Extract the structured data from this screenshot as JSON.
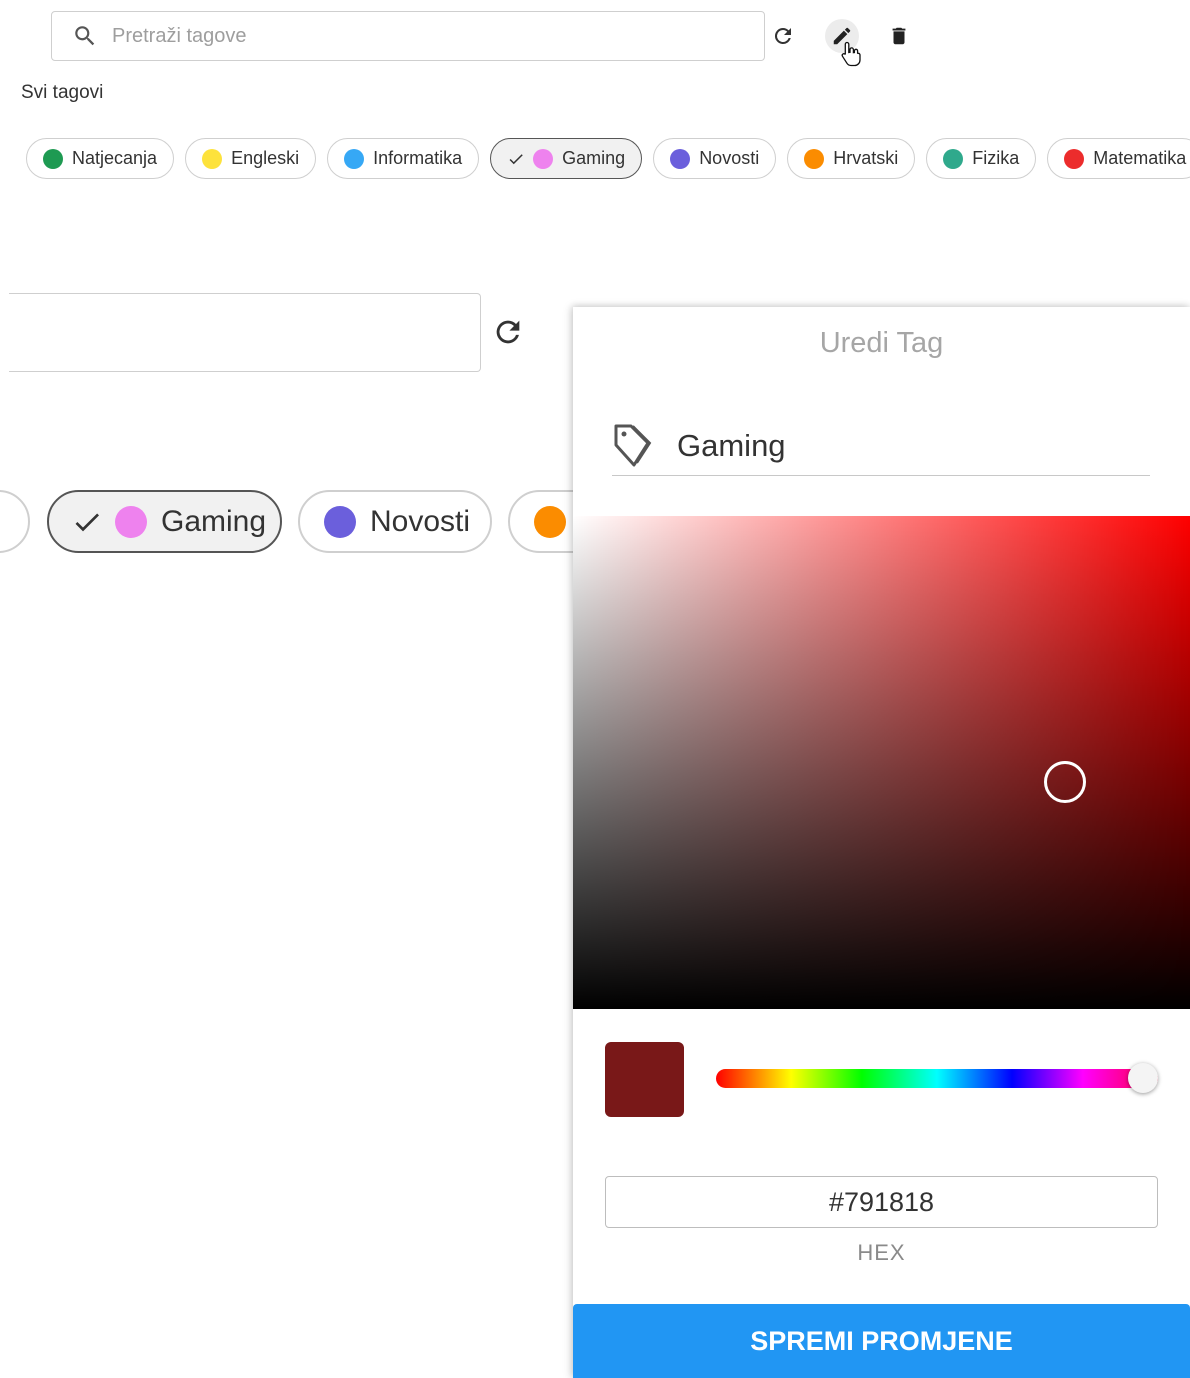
{
  "search": {
    "placeholder": "Pretraži tagove"
  },
  "toolbar": {
    "refresh_icon": "refresh-icon",
    "edit_icon": "pencil-icon",
    "delete_icon": "trash-icon"
  },
  "section_title": "Svi tagovi",
  "tags": [
    {
      "label": "Natjecanja",
      "color": "#1e9a52",
      "selected": false
    },
    {
      "label": "Engleski",
      "color": "#fde23c",
      "selected": false
    },
    {
      "label": "Informatika",
      "color": "#36a8f5",
      "selected": false
    },
    {
      "label": "Gaming",
      "color": "#ee82ee",
      "selected": true
    },
    {
      "label": "Novosti",
      "color": "#6b5fdc",
      "selected": false
    },
    {
      "label": "Hrvatski",
      "color": "#fb8c00",
      "selected": false
    },
    {
      "label": "Fizika",
      "color": "#2fa98c",
      "selected": false
    },
    {
      "label": "Matematika",
      "color": "#ec2c2c",
      "selected": false
    }
  ],
  "zoom_view": {
    "chips": [
      {
        "label": "Gaming",
        "color": "#ee82ee",
        "selected": true
      },
      {
        "label": "Novosti",
        "color": "#6b5fdc",
        "selected": false
      },
      {
        "label": "",
        "color": "#fb8c00",
        "selected": false
      }
    ]
  },
  "edit_panel": {
    "title": "Uredi Tag",
    "name_value": "Gaming",
    "selected_color": "#791818",
    "hue_base_color": "#ff0000",
    "hex_value": "#791818",
    "hex_label": "HEX",
    "save_label": "SPREMI PROMJENE",
    "save_color": "#2196f3"
  }
}
